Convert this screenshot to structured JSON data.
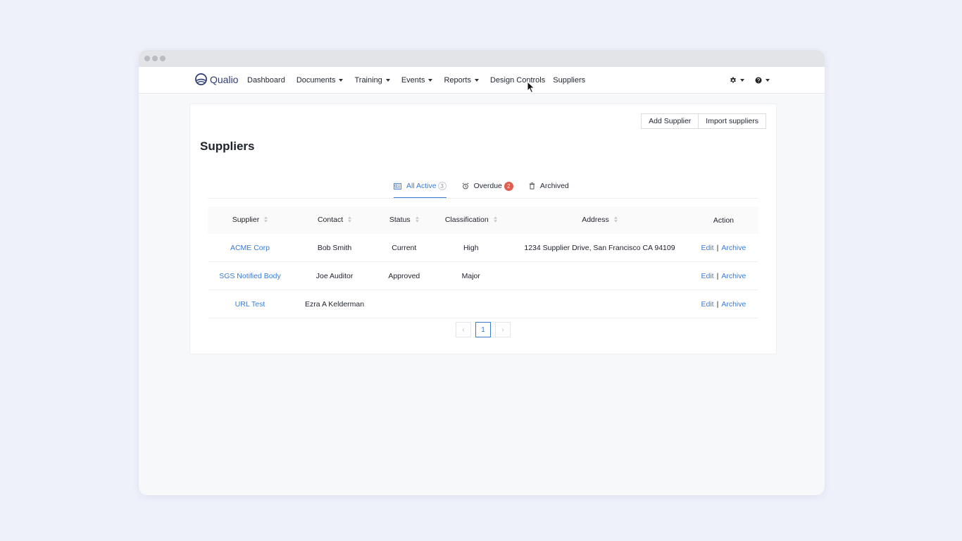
{
  "brand": {
    "name": "Qualio"
  },
  "nav": {
    "items": [
      {
        "label": "Dashboard",
        "dropdown": false
      },
      {
        "label": "Documents",
        "dropdown": true
      },
      {
        "label": "Training",
        "dropdown": true
      },
      {
        "label": "Events",
        "dropdown": true
      },
      {
        "label": "Reports",
        "dropdown": true
      },
      {
        "label": "Design Controls",
        "dropdown": false
      },
      {
        "label": "Suppliers",
        "dropdown": false
      }
    ],
    "right_icons": [
      "gear-icon",
      "help-icon"
    ]
  },
  "page": {
    "title": "Suppliers",
    "add_button": "Add Supplier",
    "import_button": "Import suppliers"
  },
  "tabs": [
    {
      "label": "All Active",
      "count": "3",
      "icon": "id-card-icon",
      "active": true
    },
    {
      "label": "Overdue",
      "count": "2",
      "icon": "alarm-icon",
      "active": false
    },
    {
      "label": "Archived",
      "count": "",
      "icon": "trash-icon",
      "active": false
    }
  ],
  "table": {
    "columns": [
      "Supplier",
      "Contact",
      "Status",
      "Classification",
      "Address",
      "Action"
    ],
    "rows": [
      {
        "supplier": "ACME Corp",
        "contact": "Bob Smith",
        "status": "Current",
        "classification": "High",
        "address": "1234 Supplier Drive, San Francisco CA 94109"
      },
      {
        "supplier": "SGS Notified Body",
        "contact": "Joe Auditor",
        "status": "Approved",
        "classification": "Major",
        "address": ""
      },
      {
        "supplier": "URL Test",
        "contact": "Ezra A Kelderman",
        "status": "",
        "classification": "",
        "address": ""
      }
    ],
    "actions": {
      "edit": "Edit",
      "separator": "|",
      "archive": "Archive"
    }
  },
  "pagination": {
    "prev": "‹",
    "current": "1",
    "next": "›"
  },
  "colors": {
    "accent": "#3a7bd5",
    "badge": "#e25b4f",
    "brand": "#2d3c74"
  }
}
